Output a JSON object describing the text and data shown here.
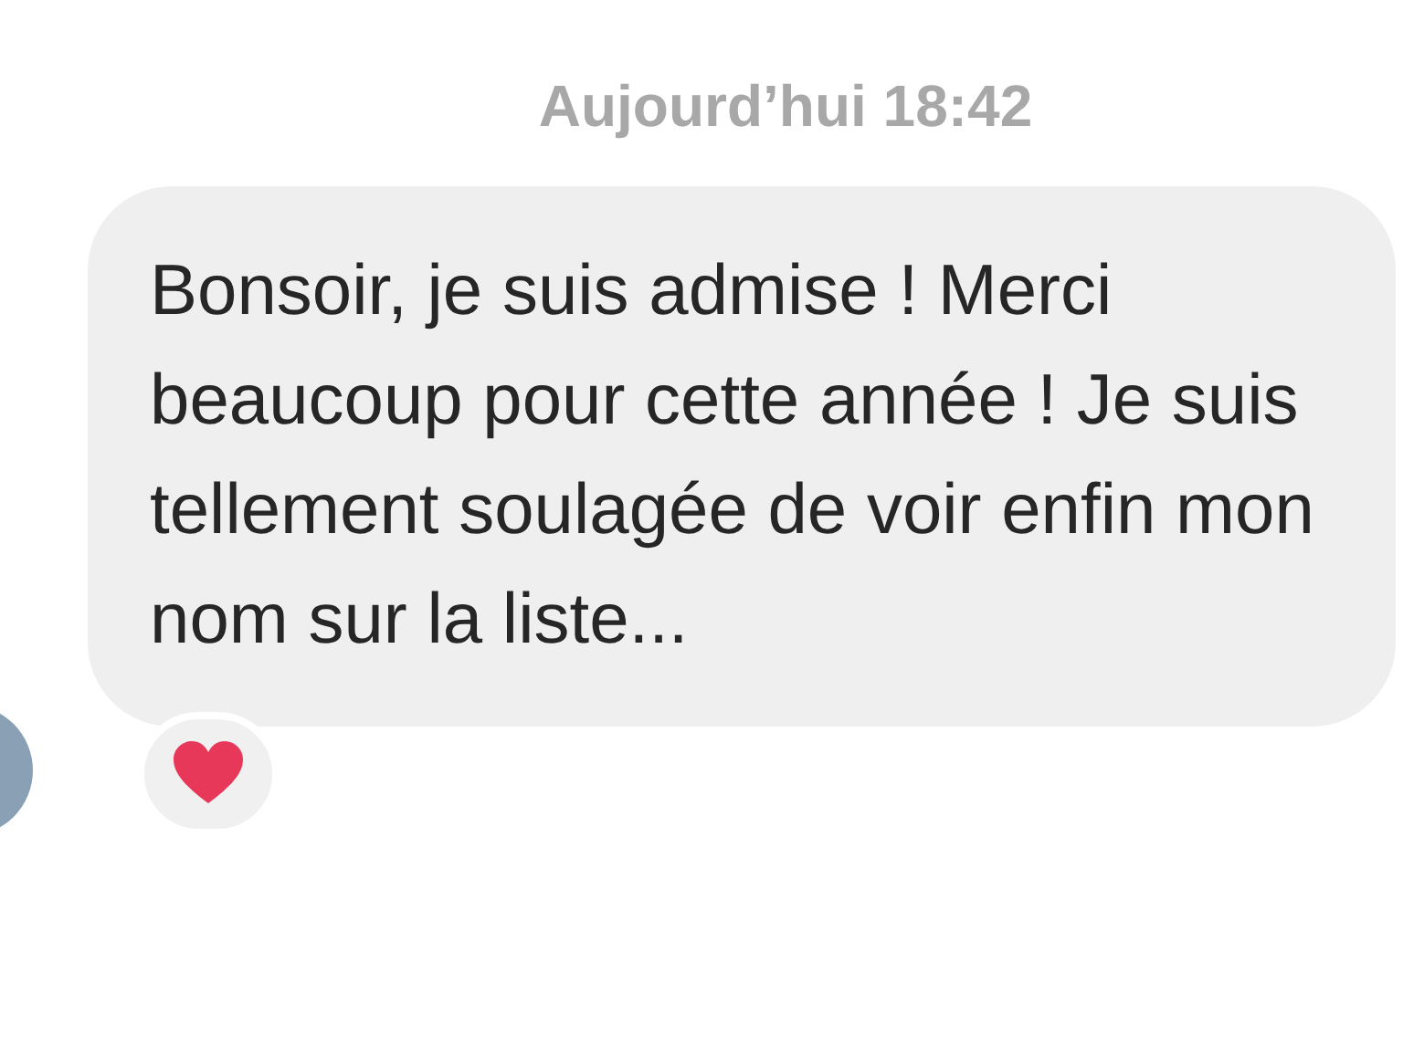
{
  "timestamp": "Aujourd’hui 18:42",
  "message": {
    "text": "Bonsoir, je suis admise ! Merci beaucoup pour cette année ! Je suis tellement soulagée de voir enfin mon nom sur la liste...",
    "reaction": {
      "kind": "heart"
    }
  }
}
